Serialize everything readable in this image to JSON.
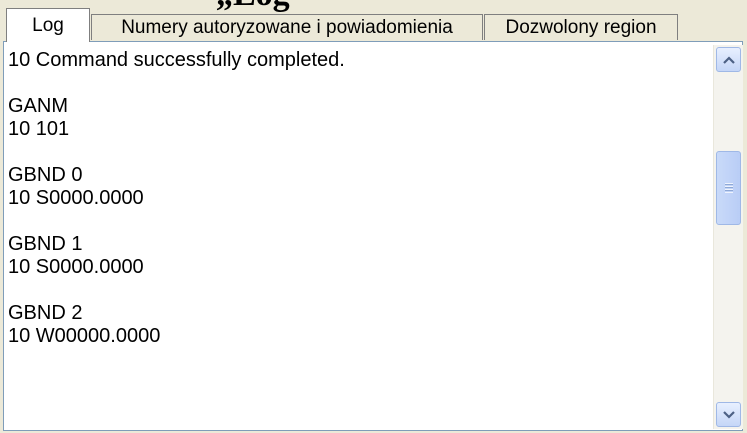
{
  "heading_fragment": "„Log",
  "tabs": [
    {
      "label": "Log",
      "active": true
    },
    {
      "label": "Numery autoryzowane i powiadomienia",
      "active": false
    },
    {
      "label": "Dozwolony region",
      "active": false
    }
  ],
  "log": {
    "entries": [
      [
        "10 Command successfully completed."
      ],
      [
        "GANM",
        "10 101"
      ],
      [
        "GBND 0",
        "10 S0000.0000"
      ],
      [
        "GBND 1",
        "10 S0000.0000"
      ],
      [
        "GBND 2",
        "10 W00000.0000"
      ]
    ]
  },
  "scrollbar": {
    "up_icon": "arrow-up-icon",
    "down_icon": "arrow-down-icon",
    "grip_icon": "grip-icon"
  },
  "colors": {
    "window_bg": "#ece9d8",
    "panel_border": "#7f9db9",
    "scrollbar_accent": "#9fb8e6"
  }
}
